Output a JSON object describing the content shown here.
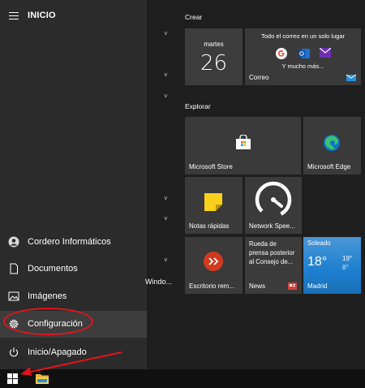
{
  "header": {
    "title": "INICIO"
  },
  "nav": [
    {
      "label": "Cordero Informáticos",
      "icon": "user-icon"
    },
    {
      "label": "Documentos",
      "icon": "document-icon"
    },
    {
      "label": "Imágenes",
      "icon": "image-icon"
    },
    {
      "label": "Configuración",
      "icon": "gear-icon"
    },
    {
      "label": "Inicio/Apagado",
      "icon": "power-icon"
    }
  ],
  "truncated_label": "Windo...",
  "groups": {
    "crear": "Crear",
    "explorar": "Explorar"
  },
  "tiles": {
    "calendar": {
      "day_name": "martes",
      "day_num": "26"
    },
    "mail": {
      "heading": "Todo el correo en un solo lugar",
      "more": "Y mucho más...",
      "label": "Correo"
    },
    "store": {
      "label": "Microsoft Store"
    },
    "edge": {
      "label": "Microsoft Edge"
    },
    "notes": {
      "label": "Notas rápidas"
    },
    "speed": {
      "label": "Network Spee..."
    },
    "news": {
      "text": "Rueda de prensa posterior al Consejo de...",
      "label": "News"
    },
    "remote": {
      "label": "Escritorio rem..."
    },
    "weather": {
      "condition": "Soleado",
      "temp": "18°",
      "high": "19°",
      "low": "8°",
      "city": "Madrid"
    }
  },
  "colors": {
    "accent_red": "#e0141b",
    "weather_bg": "#1c7fcf",
    "notes_yellow": "#f8d01c",
    "remote_red": "#d13a1f"
  }
}
